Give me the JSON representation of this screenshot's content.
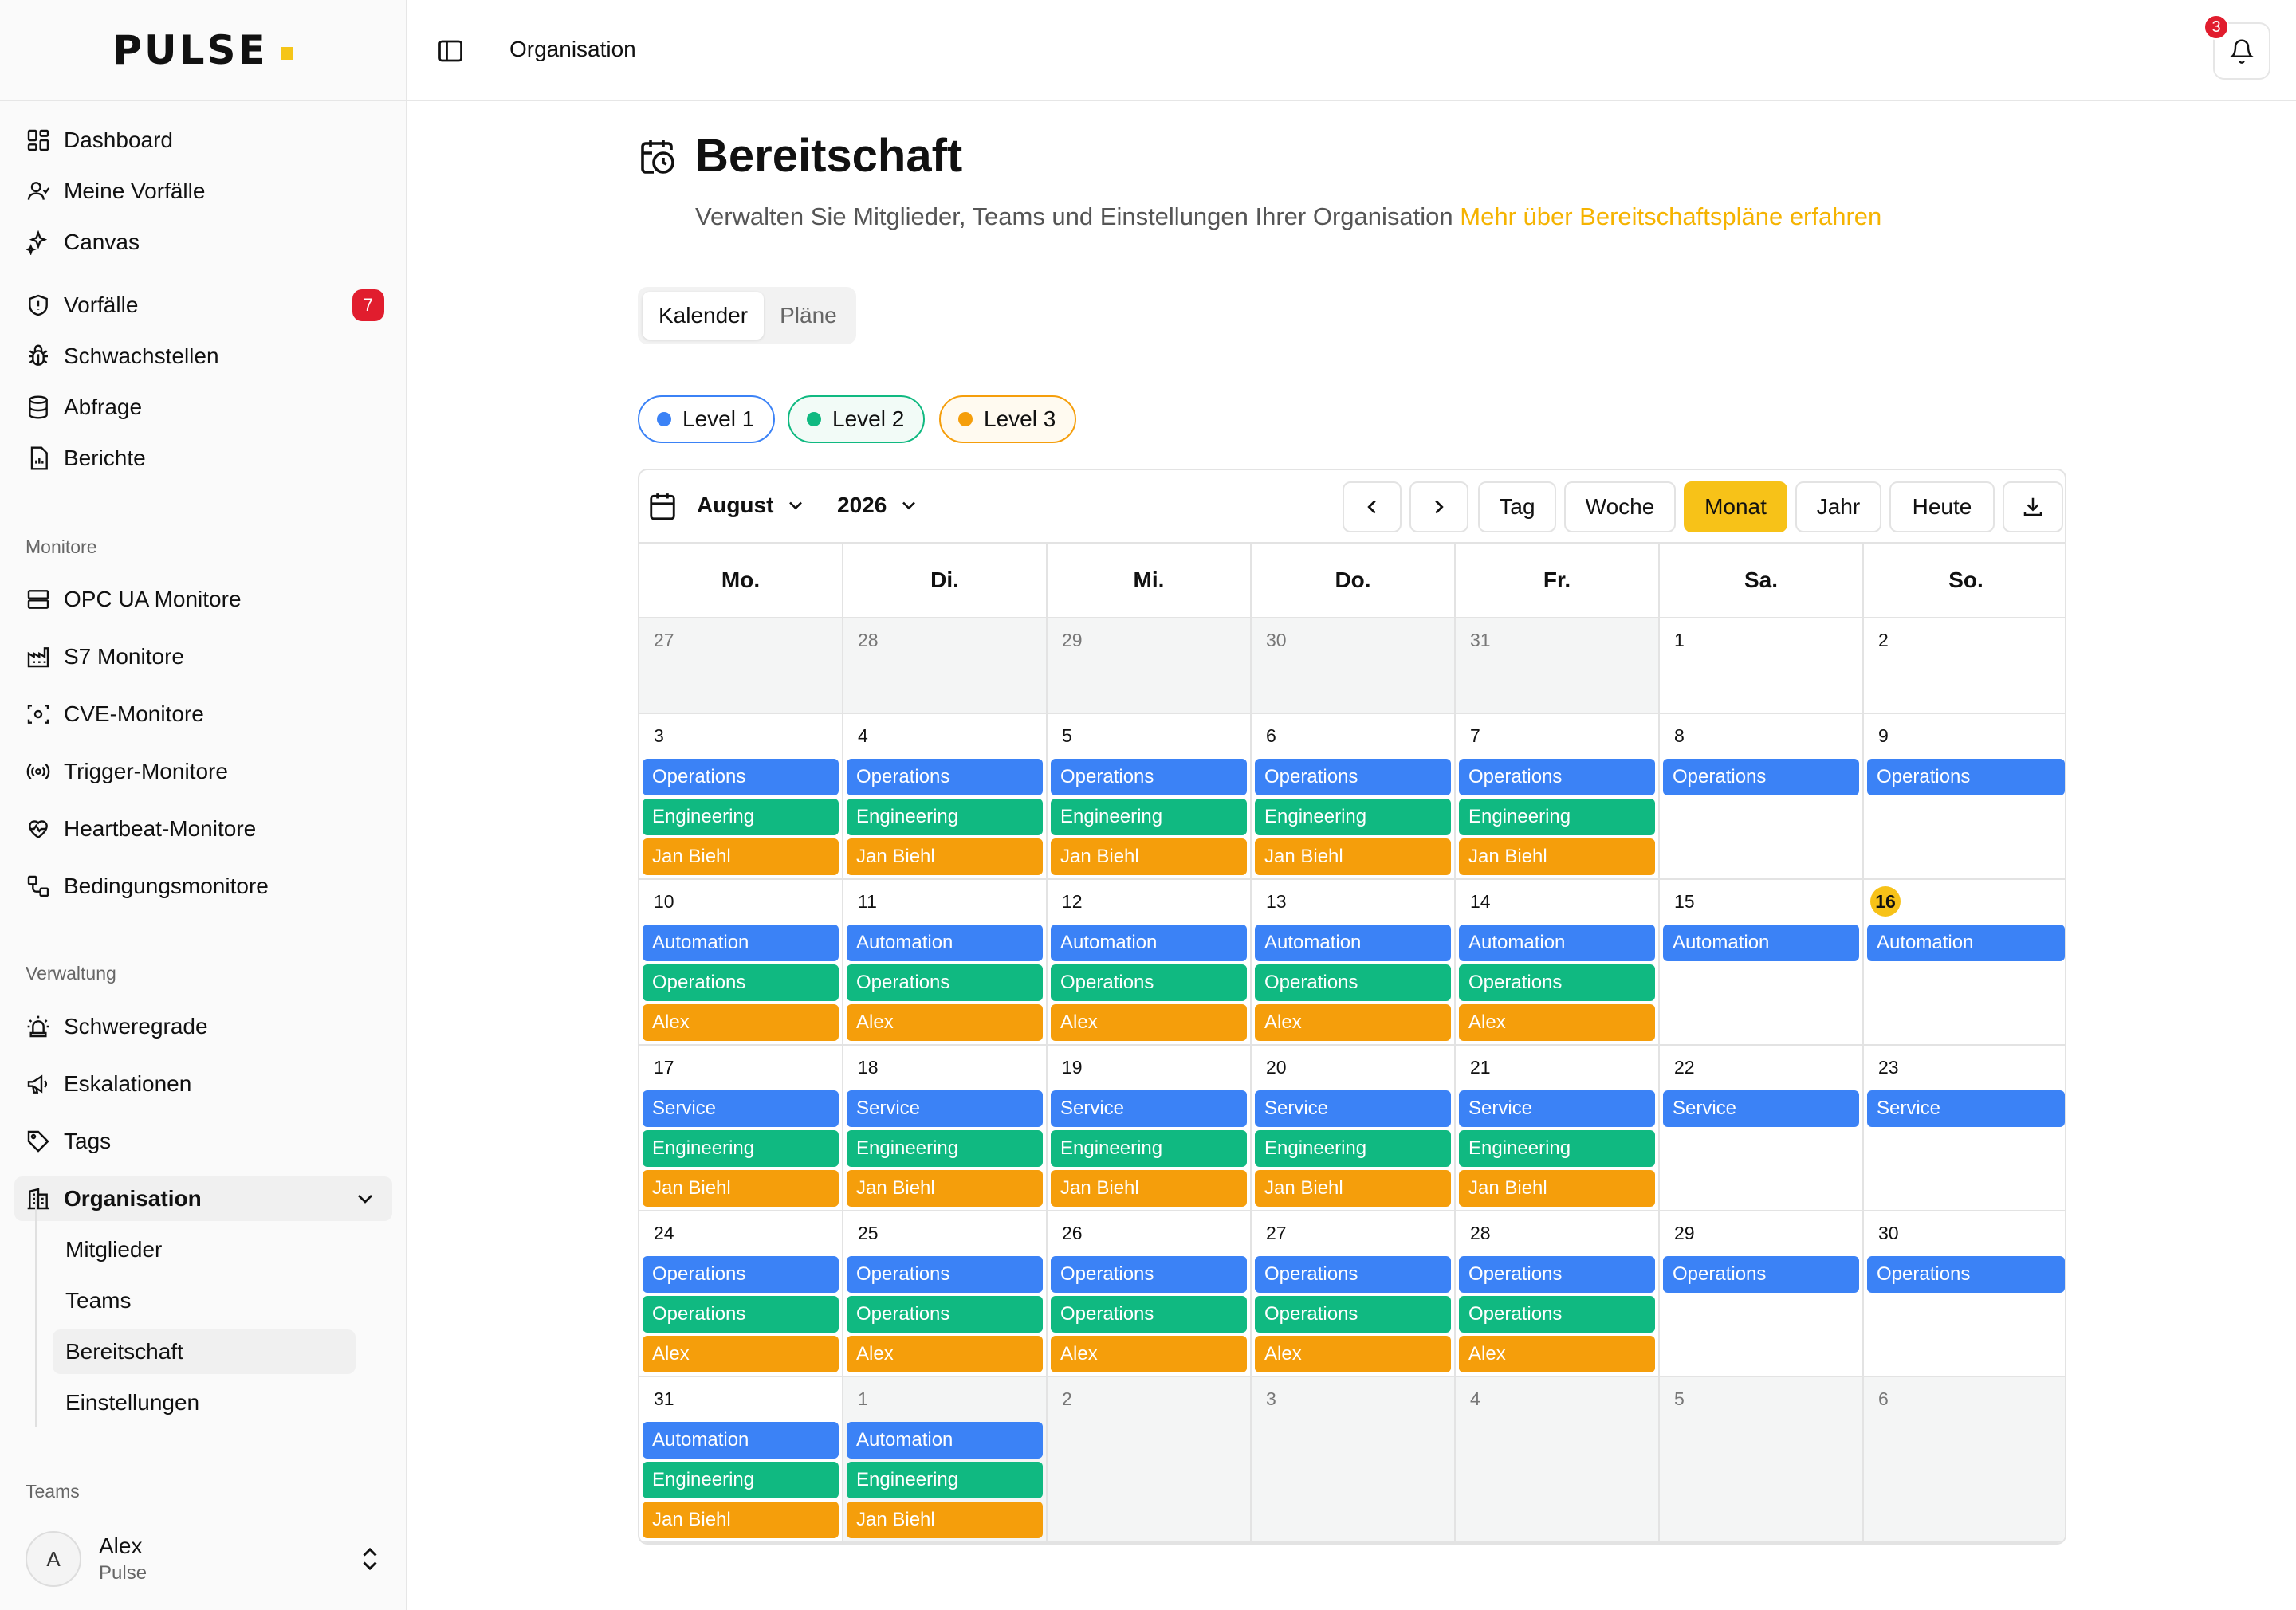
{
  "app": {
    "logo": "PULSE"
  },
  "sidebar": {
    "main": [
      {
        "label": "Dashboard",
        "icon": "dashboard-icon"
      },
      {
        "label": "Meine Vorfälle",
        "icon": "user-icon"
      },
      {
        "label": "Canvas",
        "icon": "sparkles-icon"
      },
      {
        "label": "Vorfälle",
        "icon": "shield-icon",
        "badge": "7"
      },
      {
        "label": "Schwachstellen",
        "icon": "bug-icon"
      },
      {
        "label": "Abfrage",
        "icon": "database-icon"
      },
      {
        "label": "Berichte",
        "icon": "report-icon"
      }
    ],
    "monitors_label": "Monitore",
    "monitors": [
      {
        "label": "OPC UA Monitore",
        "icon": "server-icon"
      },
      {
        "label": "S7 Monitore",
        "icon": "factory-icon"
      },
      {
        "label": "CVE-Monitore",
        "icon": "scan-icon"
      },
      {
        "label": "Trigger-Monitore",
        "icon": "radio-icon"
      },
      {
        "label": "Heartbeat-Monitore",
        "icon": "heart-pulse-icon"
      },
      {
        "label": "Bedingungsmonitore",
        "icon": "workflow-icon"
      }
    ],
    "admin_label": "Verwaltung",
    "admin": [
      {
        "label": "Schweregrade",
        "icon": "siren-icon"
      },
      {
        "label": "Eskalationen",
        "icon": "megaphone-icon"
      },
      {
        "label": "Tags",
        "icon": "tag-icon"
      },
      {
        "label": "Organisation",
        "icon": "building-icon"
      }
    ],
    "org_sub": [
      "Mitglieder",
      "Teams",
      "Bereitschaft",
      "Einstellungen"
    ],
    "teams_label": "Teams",
    "user": {
      "initial": "A",
      "name": "Alex",
      "org": "Pulse"
    }
  },
  "header": {
    "breadcrumb": "Organisation",
    "notifications": "3"
  },
  "page": {
    "title": "Bereitschaft",
    "description": "Verwalten Sie Mitglieder, Teams und Einstellungen Ihrer Organisation",
    "link": "Mehr über Bereitschaftspläne erfahren",
    "tabs": [
      "Kalender",
      "Pläne"
    ]
  },
  "levels": [
    {
      "label": "Level 1",
      "color": "#3b82f6"
    },
    {
      "label": "Level 2",
      "color": "#10b981"
    },
    {
      "label": "Level 3",
      "color": "#f59e0b"
    }
  ],
  "calendar": {
    "month": "August",
    "year": "2026",
    "views": [
      "Tag",
      "Woche",
      "Monat",
      "Jahr",
      "Heute"
    ],
    "active_view": "Monat",
    "weekdays": [
      "Mo.",
      "Di.",
      "Mi.",
      "Do.",
      "Fr.",
      "Sa.",
      "So."
    ],
    "weeks": [
      [
        {
          "d": "27",
          "out": true,
          "ev": []
        },
        {
          "d": "28",
          "out": true,
          "ev": []
        },
        {
          "d": "29",
          "out": true,
          "ev": []
        },
        {
          "d": "30",
          "out": true,
          "ev": []
        },
        {
          "d": "31",
          "out": true,
          "ev": []
        },
        {
          "d": "1",
          "ev": []
        },
        {
          "d": "2",
          "ev": []
        }
      ],
      [
        {
          "d": "3",
          "ev": [
            "Operations",
            "Engineering",
            "Jan Biehl"
          ]
        },
        {
          "d": "4",
          "ev": [
            "Operations",
            "Engineering",
            "Jan Biehl"
          ]
        },
        {
          "d": "5",
          "ev": [
            "Operations",
            "Engineering",
            "Jan Biehl"
          ]
        },
        {
          "d": "6",
          "ev": [
            "Operations",
            "Engineering",
            "Jan Biehl"
          ]
        },
        {
          "d": "7",
          "ev": [
            "Operations",
            "Engineering",
            "Jan Biehl"
          ]
        },
        {
          "d": "8",
          "ev": [
            "Operations"
          ]
        },
        {
          "d": "9",
          "ev": [
            "Operations"
          ]
        }
      ],
      [
        {
          "d": "10",
          "ev": [
            "Automation",
            "Operations",
            "Alex"
          ]
        },
        {
          "d": "11",
          "ev": [
            "Automation",
            "Operations",
            "Alex"
          ]
        },
        {
          "d": "12",
          "ev": [
            "Automation",
            "Operations",
            "Alex"
          ]
        },
        {
          "d": "13",
          "ev": [
            "Automation",
            "Operations",
            "Alex"
          ]
        },
        {
          "d": "14",
          "ev": [
            "Automation",
            "Operations",
            "Alex"
          ]
        },
        {
          "d": "15",
          "ev": [
            "Automation"
          ]
        },
        {
          "d": "16",
          "today": true,
          "ev": [
            "Automation"
          ]
        }
      ],
      [
        {
          "d": "17",
          "ev": [
            "Service",
            "Engineering",
            "Jan Biehl"
          ]
        },
        {
          "d": "18",
          "ev": [
            "Service",
            "Engineering",
            "Jan Biehl"
          ]
        },
        {
          "d": "19",
          "ev": [
            "Service",
            "Engineering",
            "Jan Biehl"
          ]
        },
        {
          "d": "20",
          "ev": [
            "Service",
            "Engineering",
            "Jan Biehl"
          ]
        },
        {
          "d": "21",
          "ev": [
            "Service",
            "Engineering",
            "Jan Biehl"
          ]
        },
        {
          "d": "22",
          "ev": [
            "Service"
          ]
        },
        {
          "d": "23",
          "ev": [
            "Service"
          ]
        }
      ],
      [
        {
          "d": "24",
          "ev": [
            "Operations",
            "Operations",
            "Alex"
          ]
        },
        {
          "d": "25",
          "ev": [
            "Operations",
            "Operations",
            "Alex"
          ]
        },
        {
          "d": "26",
          "ev": [
            "Operations",
            "Operations",
            "Alex"
          ]
        },
        {
          "d": "27",
          "ev": [
            "Operations",
            "Operations",
            "Alex"
          ]
        },
        {
          "d": "28",
          "ev": [
            "Operations",
            "Operations",
            "Alex"
          ]
        },
        {
          "d": "29",
          "ev": [
            "Operations"
          ]
        },
        {
          "d": "30",
          "ev": [
            "Operations"
          ]
        }
      ],
      [
        {
          "d": "31",
          "ev": [
            "Automation",
            "Engineering",
            "Jan Biehl"
          ]
        },
        {
          "d": "1",
          "out": true,
          "ev": [
            "Automation",
            "Engineering",
            "Jan Biehl"
          ]
        },
        {
          "d": "2",
          "out": true,
          "ev": []
        },
        {
          "d": "3",
          "out": true,
          "ev": []
        },
        {
          "d": "4",
          "out": true,
          "ev": []
        },
        {
          "d": "5",
          "out": true,
          "ev": []
        },
        {
          "d": "6",
          "out": true,
          "ev": []
        }
      ]
    ]
  }
}
